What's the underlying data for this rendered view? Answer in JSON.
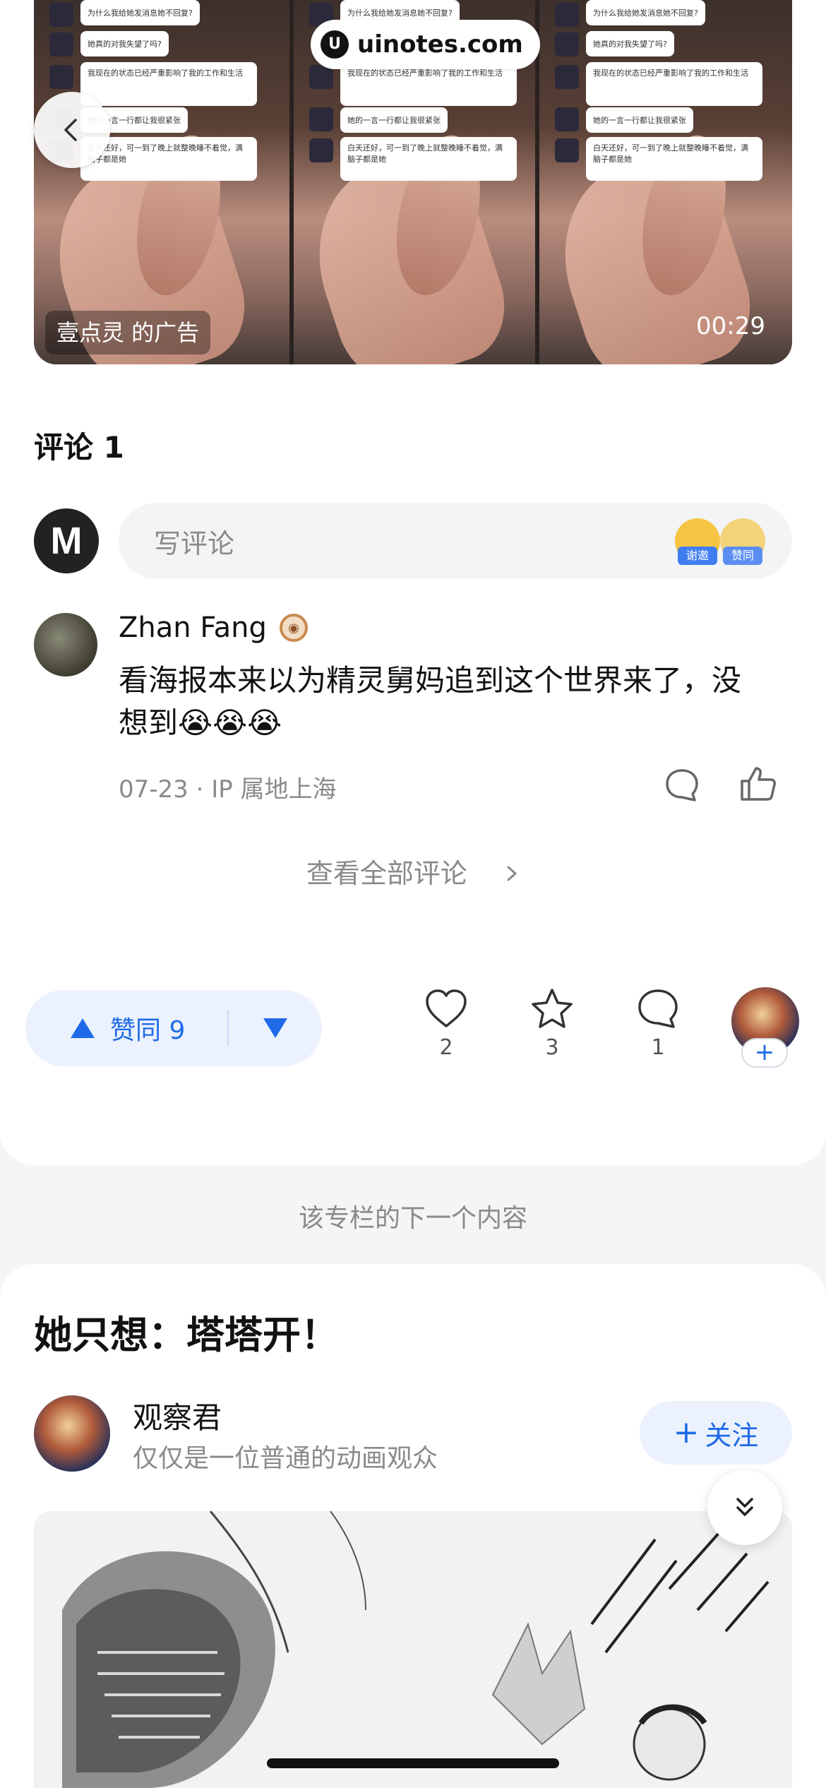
{
  "ad": {
    "watermark": "uinotes.com",
    "label": "壹点灵 的广告",
    "duration": "00:29",
    "chat_lines": [
      "为什么我给她发消息她不回复?",
      "她真的对我失望了吗?",
      "我现在的状态已经严重影响了我的工作和生活",
      "她的一言一行都让我很紧张",
      "白天还好，可一到了晚上就整晚睡不着觉，满脑子都是她"
    ]
  },
  "comments": {
    "title": "评论 1",
    "input_placeholder": "写评论",
    "emoji_chips": [
      "谢邀",
      "赞同"
    ],
    "items": [
      {
        "author": "Zhan Fang",
        "text": "看海报本来以为精灵舅妈追到这个世界来了，没想到😭😭😭",
        "meta": "07-23 ·  IP 属地上海"
      }
    ],
    "view_all": "查看全部评论"
  },
  "actions": {
    "vote_label": "赞同 9",
    "likes": "2",
    "favorites": "3",
    "comments": "1",
    "plus": "+"
  },
  "next_section_label": "该专栏的下一个内容",
  "next_article": {
    "title": "她只想：塔塔开！",
    "author": "观察君",
    "bio": "仅仅是一位普通的动画观众",
    "follow_label": "关注"
  },
  "colors": {
    "accent": "#1f6ae8",
    "accent_bg": "#ebf2fd",
    "muted_text": "#8a8a8a"
  }
}
